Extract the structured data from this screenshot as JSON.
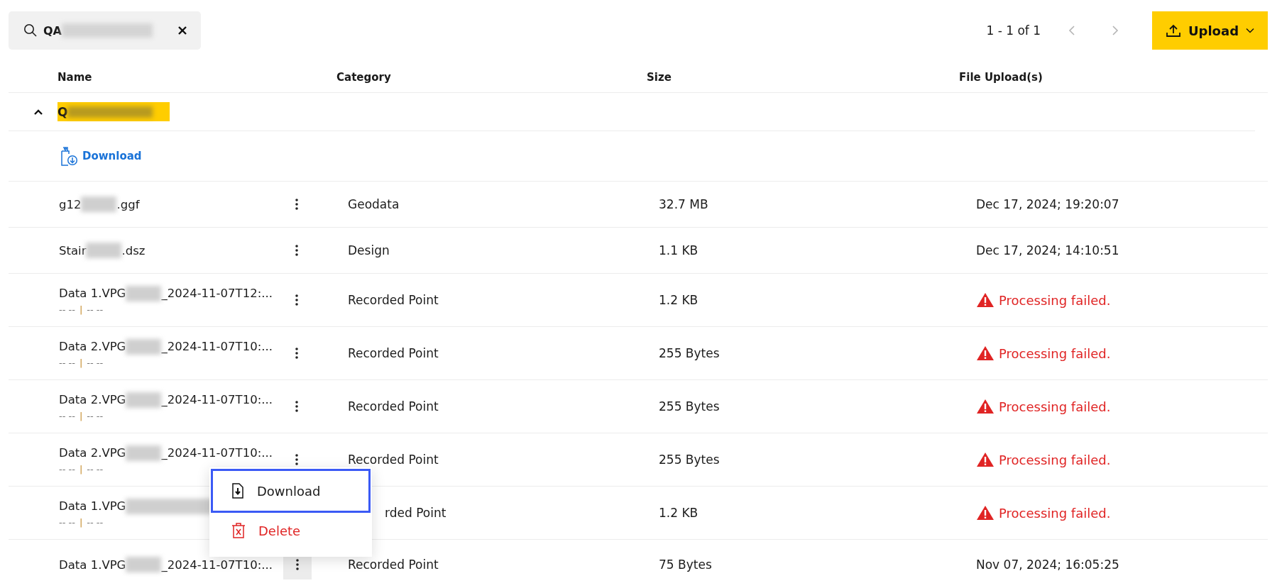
{
  "search": {
    "value_parts": [
      "QA"
    ],
    "redacted_tail": true
  },
  "pagination": {
    "range": "1 - 1 of 1",
    "prev_disabled": true,
    "next_disabled": true
  },
  "upload_button": {
    "label": "Upload"
  },
  "table": {
    "columns": [
      "Name",
      "Category",
      "Size",
      "File Upload(s)"
    ],
    "group": {
      "name_parts": [
        "Q"
      ],
      "redacted_tail": true,
      "expanded": true,
      "download_label": "Download"
    },
    "rows": [
      {
        "name_parts": [
          "g12",
          ".ggf"
        ],
        "category": "Geodata",
        "size": "32.7 MB",
        "upload": {
          "kind": "date",
          "text": "Dec 17, 2024; 19:20:07"
        },
        "menu_highlighted": false
      },
      {
        "name_parts": [
          "Stair",
          ".dsz"
        ],
        "category": "Design",
        "size": "1.1 KB",
        "upload": {
          "kind": "date",
          "text": "Dec 17, 2024; 14:10:51"
        },
        "menu_highlighted": false
      },
      {
        "name_parts": [
          "Data 1.VPG",
          "_2024-11-07T12:..."
        ],
        "meta": [
          "-- --",
          "|",
          "-- --"
        ],
        "category": "Recorded Point",
        "size": "1.2 KB",
        "upload": {
          "kind": "error",
          "text": "Processing failed."
        },
        "menu_highlighted": false
      },
      {
        "name_parts": [
          "Data 2.VPG",
          "_2024-11-07T10:..."
        ],
        "meta": [
          "-- --",
          "|",
          "-- --"
        ],
        "category": "Recorded Point",
        "size": "255 Bytes",
        "upload": {
          "kind": "error",
          "text": "Processing failed."
        },
        "menu_highlighted": false
      },
      {
        "name_parts": [
          "Data 2.VPG",
          "_2024-11-07T10:..."
        ],
        "meta": [
          "-- --",
          "|",
          "-- --"
        ],
        "category": "Recorded Point",
        "size": "255 Bytes",
        "upload": {
          "kind": "error",
          "text": "Processing failed."
        },
        "menu_highlighted": false
      },
      {
        "name_parts": [
          "Data 2.VPG",
          "_2024-11-07T10:..."
        ],
        "meta": [
          "-- --",
          "|",
          "-- --"
        ],
        "category": "Recorded Point",
        "size": "255 Bytes",
        "upload": {
          "kind": "error",
          "text": "Processing failed."
        },
        "menu_highlighted": false
      },
      {
        "name_parts": [
          "Data 1.VPG"
        ],
        "redacted_tail": true,
        "meta": [
          "-- --",
          "|",
          "-- --"
        ],
        "category": "rded Point",
        "size": "1.2 KB",
        "upload": {
          "kind": "error",
          "text": "Processing failed."
        }
      },
      {
        "name_parts": [
          "Data 1.VPG",
          "_2024-11-07T10:..."
        ],
        "category": "Recorded Point",
        "size": "75 Bytes",
        "upload": {
          "kind": "date",
          "text": "Nov 07, 2024; 16:05:25"
        },
        "menu_highlighted": true
      }
    ]
  },
  "context_menu": {
    "items": [
      {
        "kind": "default",
        "label": "Download",
        "selected": true
      },
      {
        "kind": "danger",
        "label": "Delete",
        "selected": false
      }
    ]
  }
}
